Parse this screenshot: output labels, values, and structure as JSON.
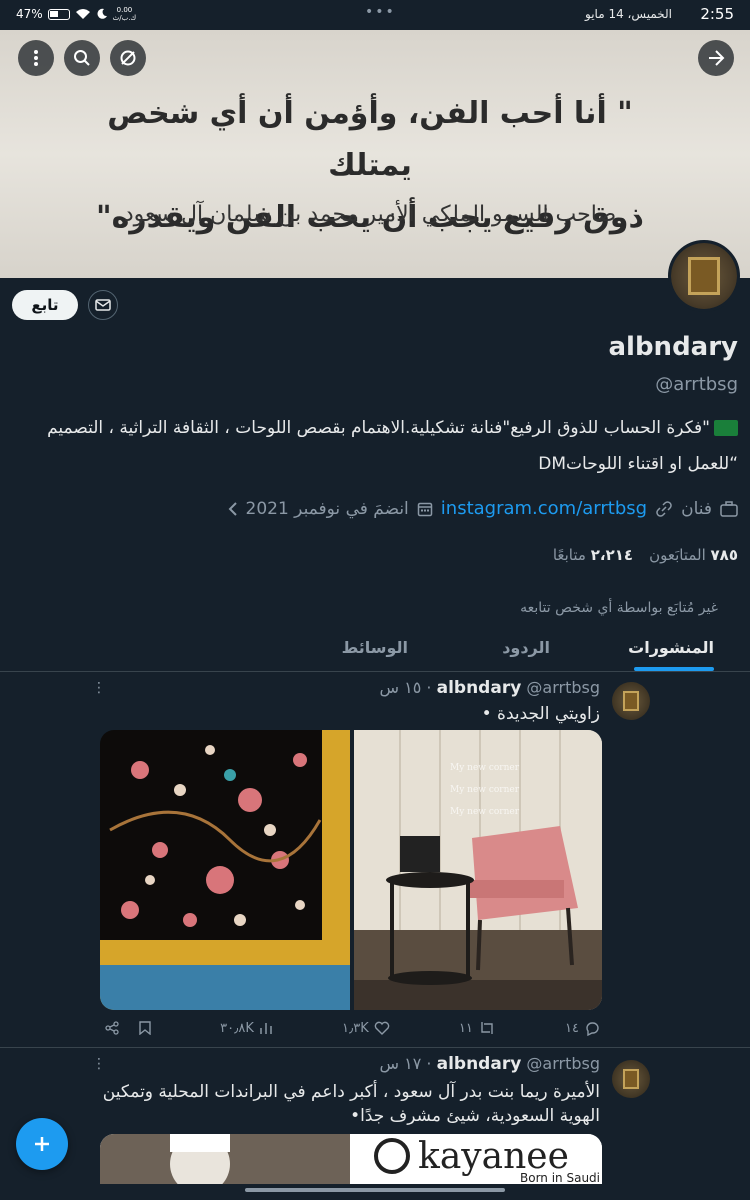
{
  "status_bar": {
    "time": "2:55",
    "date": "الخميس، 14 مايو",
    "dots": "•••",
    "battery": "47%",
    "data_rate": "0.00",
    "data_unit": "ك.ب/ث"
  },
  "banner": {
    "quote_line1": "\" أنا أحب الفن، وأؤمن أن أي شخص يمتلك",
    "quote_line2": "ذوق رفيع يجب أن يحب الفن ويقدره\"",
    "author": "صاحب السمو الملكي الأمير محمد بن سلمان آل سعود"
  },
  "profile": {
    "follow_label": "تابع",
    "name": "albndary",
    "handle": "@arrtbsg",
    "bio_line1": "\"فكرة الحساب للذوق الرفيع\"فنانة تشكيلية.الاهتمام بقصص اللوحات ، الثقافة التراثية ، التصميم",
    "bio_line2": "“للعمل او اقتناء اللوحاتDM",
    "profession": "فنان",
    "link": "instagram.com/arrtbsg",
    "joined": "انضمَ في نوفمبر 2021",
    "following_count": "٧٨٥",
    "following_label": "المتابَعون",
    "followers_count": "٢،٢١٤",
    "followers_label": "متابعًا",
    "not_followed": "غير مُتابَع بواسطة أي شخص تتابعه"
  },
  "tabs": [
    {
      "label": "المنشورات"
    },
    {
      "label": "الردود"
    },
    {
      "label": "الوسائط"
    }
  ],
  "tweets": [
    {
      "name": "albndary",
      "handle": "@arrtbsg",
      "time": "١٥ س",
      "text": "زاويتي الجديدة •",
      "media_caption": "My new corner",
      "replies": "١٤",
      "retweets": "١١",
      "likes": "١٫٣K",
      "views": "٣٠٫٨K"
    },
    {
      "name": "albndary",
      "handle": "@arrtbsg",
      "time": "١٧ س",
      "text": "الأميرة ريما بنت بدر آل سعود ، أكبر داعم في البراندات المحلية وتمكين الهوية السعودية، شيئ مشرف جدًا•",
      "media_brand": "kayanee",
      "media_tagline": "Born in Saudi"
    }
  ],
  "colors": {
    "background": "#15202b",
    "accent": "#1d9bf0",
    "muted": "#8b98a5"
  }
}
